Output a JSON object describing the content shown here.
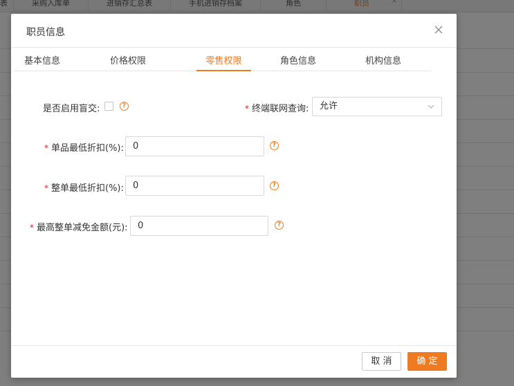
{
  "background": {
    "tabs": [
      "表",
      "采购入库单",
      "进销存汇总表",
      "手机进销存档案",
      "角色",
      "职员"
    ],
    "active_tab_close": "×"
  },
  "dialog": {
    "title": "职员信息",
    "tabs": [
      {
        "label": "基本信息",
        "active": false
      },
      {
        "label": "价格权限",
        "active": false
      },
      {
        "label": "零售权限",
        "active": true
      },
      {
        "label": "角色信息",
        "active": false
      },
      {
        "label": "机构信息",
        "active": false
      }
    ],
    "form": {
      "blind_trade": {
        "label": "是否启用盲交:",
        "checked": false
      },
      "terminal_query": {
        "required_mark": "*",
        "label": "终端联网查询:",
        "value": "允许"
      },
      "single_min_discount": {
        "required_mark": "*",
        "label": "单品最低折扣(%):",
        "value": "0"
      },
      "order_min_discount": {
        "required_mark": "*",
        "label": "整单最低折扣(%):",
        "value": "0"
      },
      "max_order_waiver": {
        "required_mark": "*",
        "label": "最高整单减免金额(元):",
        "value": "0"
      }
    },
    "buttons": {
      "cancel": "取 消",
      "ok": "确 定"
    }
  },
  "colors": {
    "accent": "#f07a20",
    "required": "#e02020"
  }
}
